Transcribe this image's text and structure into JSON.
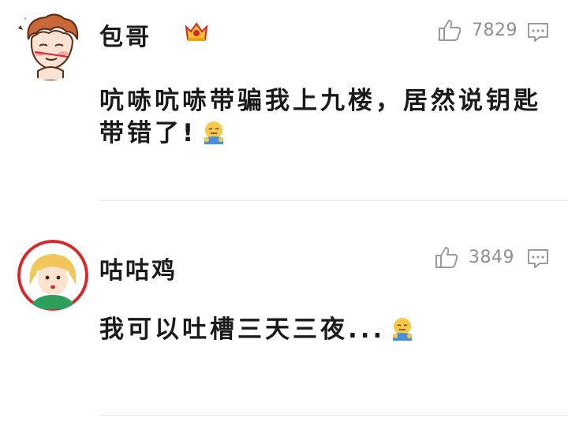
{
  "comments": [
    {
      "username": "包哥",
      "likes": "7829",
      "text": "吭哧吭哧带骗我上九楼，居然说钥匙带错了!",
      "avatar": "cartoon-boy-avatar",
      "badge": "crown-icon",
      "emoji": "speechless-emoji"
    },
    {
      "username": "咕咕鸡",
      "likes": "3849",
      "text": "我可以吐槽三天三夜...",
      "avatar": "cartoon-girl-avatar",
      "emoji": "speechless-emoji"
    }
  ],
  "colors": {
    "icon_gray": "#9a9a9a",
    "avatar_ring": "#d9262b",
    "crown": "#e8a21a"
  }
}
